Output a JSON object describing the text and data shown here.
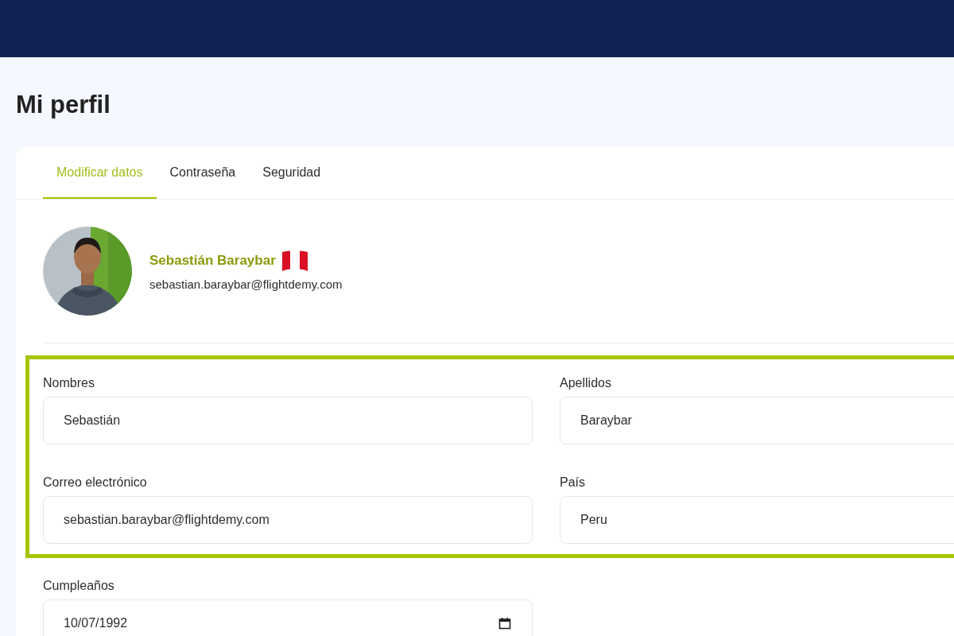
{
  "page_title": "Mi perfil",
  "tabs": [
    {
      "label": "Modificar datos",
      "selected": true
    },
    {
      "label": "Contraseña",
      "selected": false
    },
    {
      "label": "Seguridad",
      "selected": false
    }
  ],
  "profile": {
    "name": "Sebastián Baraybar",
    "email": "sebastian.baraybar@flightdemy.com"
  },
  "form": {
    "sections": [
      {
        "highlighted": true,
        "fields": [
          {
            "label": "Nombres",
            "value": "Sebastián",
            "kind": "text"
          },
          {
            "label": "Apellidos",
            "value": "Baraybar",
            "kind": "text"
          },
          {
            "label": "Correo electrónico",
            "value": "sebastian.baraybar@flightdemy.com",
            "kind": "text"
          },
          {
            "label": "País",
            "value": "Peru",
            "kind": "text"
          }
        ]
      },
      {
        "highlighted": false,
        "fields": [
          {
            "label": "Cumpleaños",
            "value": "10/07/1992",
            "kind": "date"
          }
        ]
      }
    ]
  }
}
